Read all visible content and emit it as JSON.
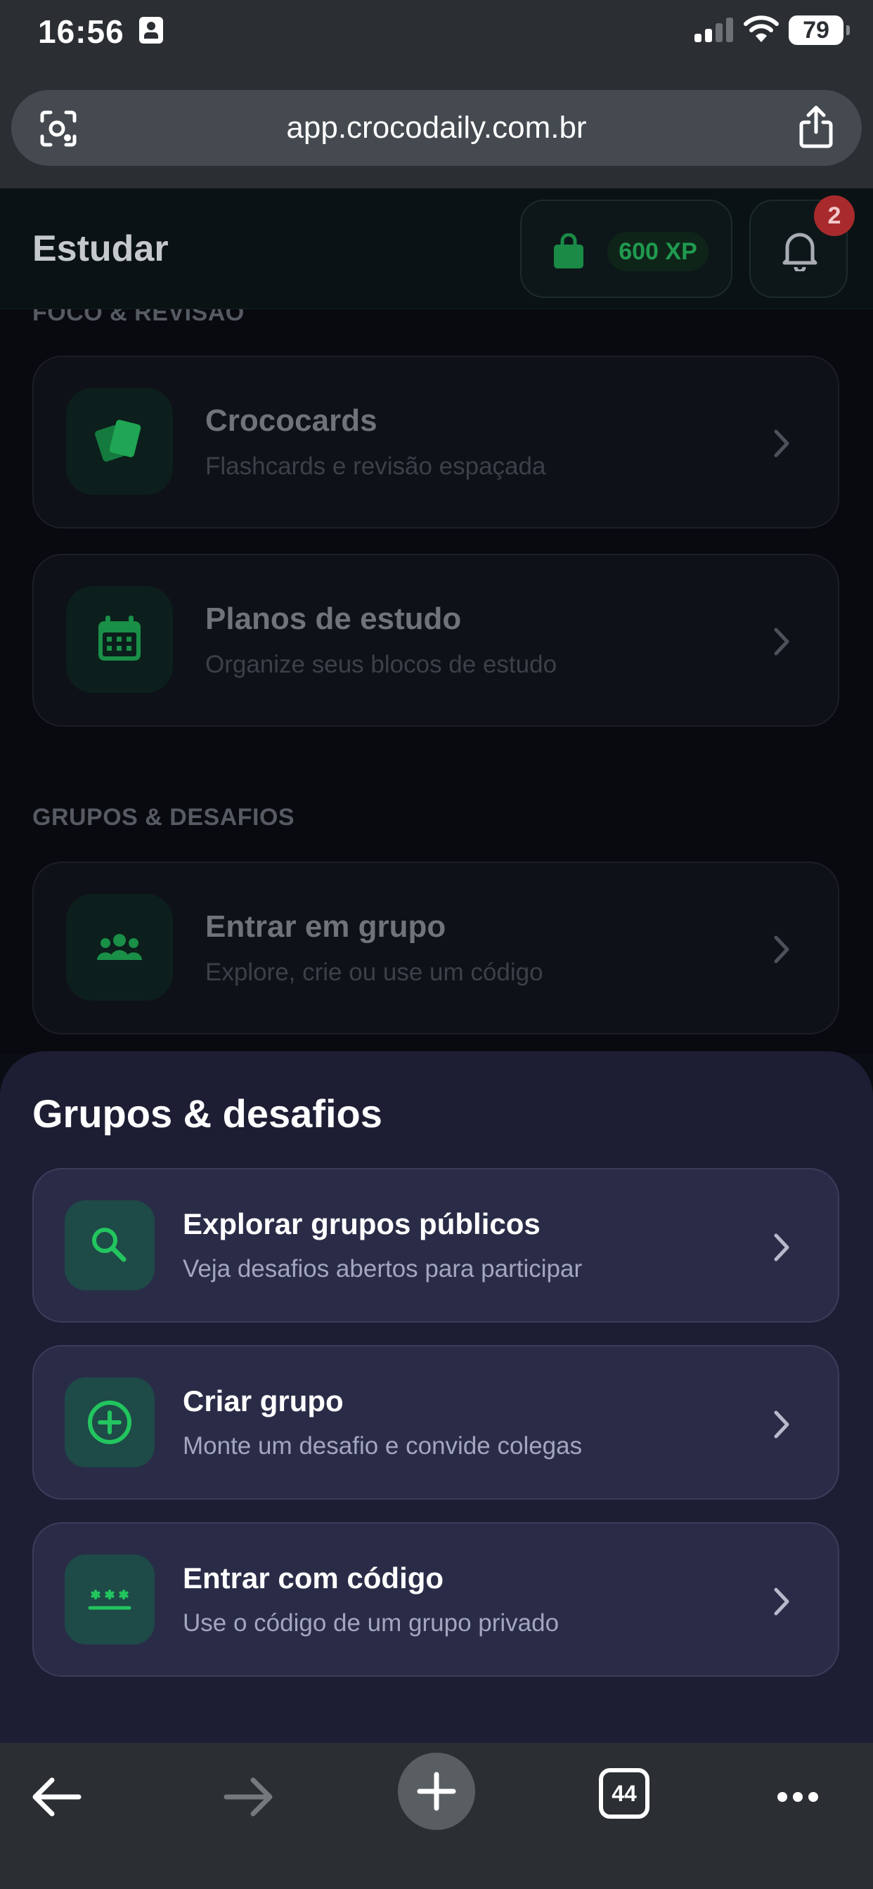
{
  "status_bar": {
    "time": "16:56",
    "battery": "79"
  },
  "browser": {
    "url": "app.crocodaily.com.br",
    "tab_count": "44"
  },
  "header": {
    "title": "Estudar",
    "xp": "600 XP",
    "notification_count": "2"
  },
  "background": {
    "section_focus": "FOCO & REVISÃO",
    "cards": [
      {
        "title": "Crococards",
        "subtitle": "Flashcards e revisão espaçada",
        "icon": "cards-icon"
      },
      {
        "title": "Planos de estudo",
        "subtitle": "Organize seus blocos de estudo",
        "icon": "calendar-icon"
      }
    ],
    "section_groups": "GRUPOS & DESAFIOS",
    "group_card": {
      "title": "Entrar em grupo",
      "subtitle": "Explore, crie ou use um código",
      "icon": "people-icon"
    }
  },
  "sheet": {
    "title": "Grupos & desafios",
    "options": [
      {
        "title": "Explorar grupos públicos",
        "subtitle": "Veja desafios abertos para participar",
        "icon": "search-icon"
      },
      {
        "title": "Criar grupo",
        "subtitle": "Monte um desafio e convide colegas",
        "icon": "plus-circle-icon"
      },
      {
        "title": "Entrar com código",
        "subtitle": "Use o código de um grupo privado",
        "icon": "code-icon"
      }
    ]
  },
  "colors": {
    "accent_green": "#22c55e",
    "sheet_bg": "#1d1e34",
    "card_bg": "#2a2c47",
    "badge_red": "#a82a2c"
  }
}
